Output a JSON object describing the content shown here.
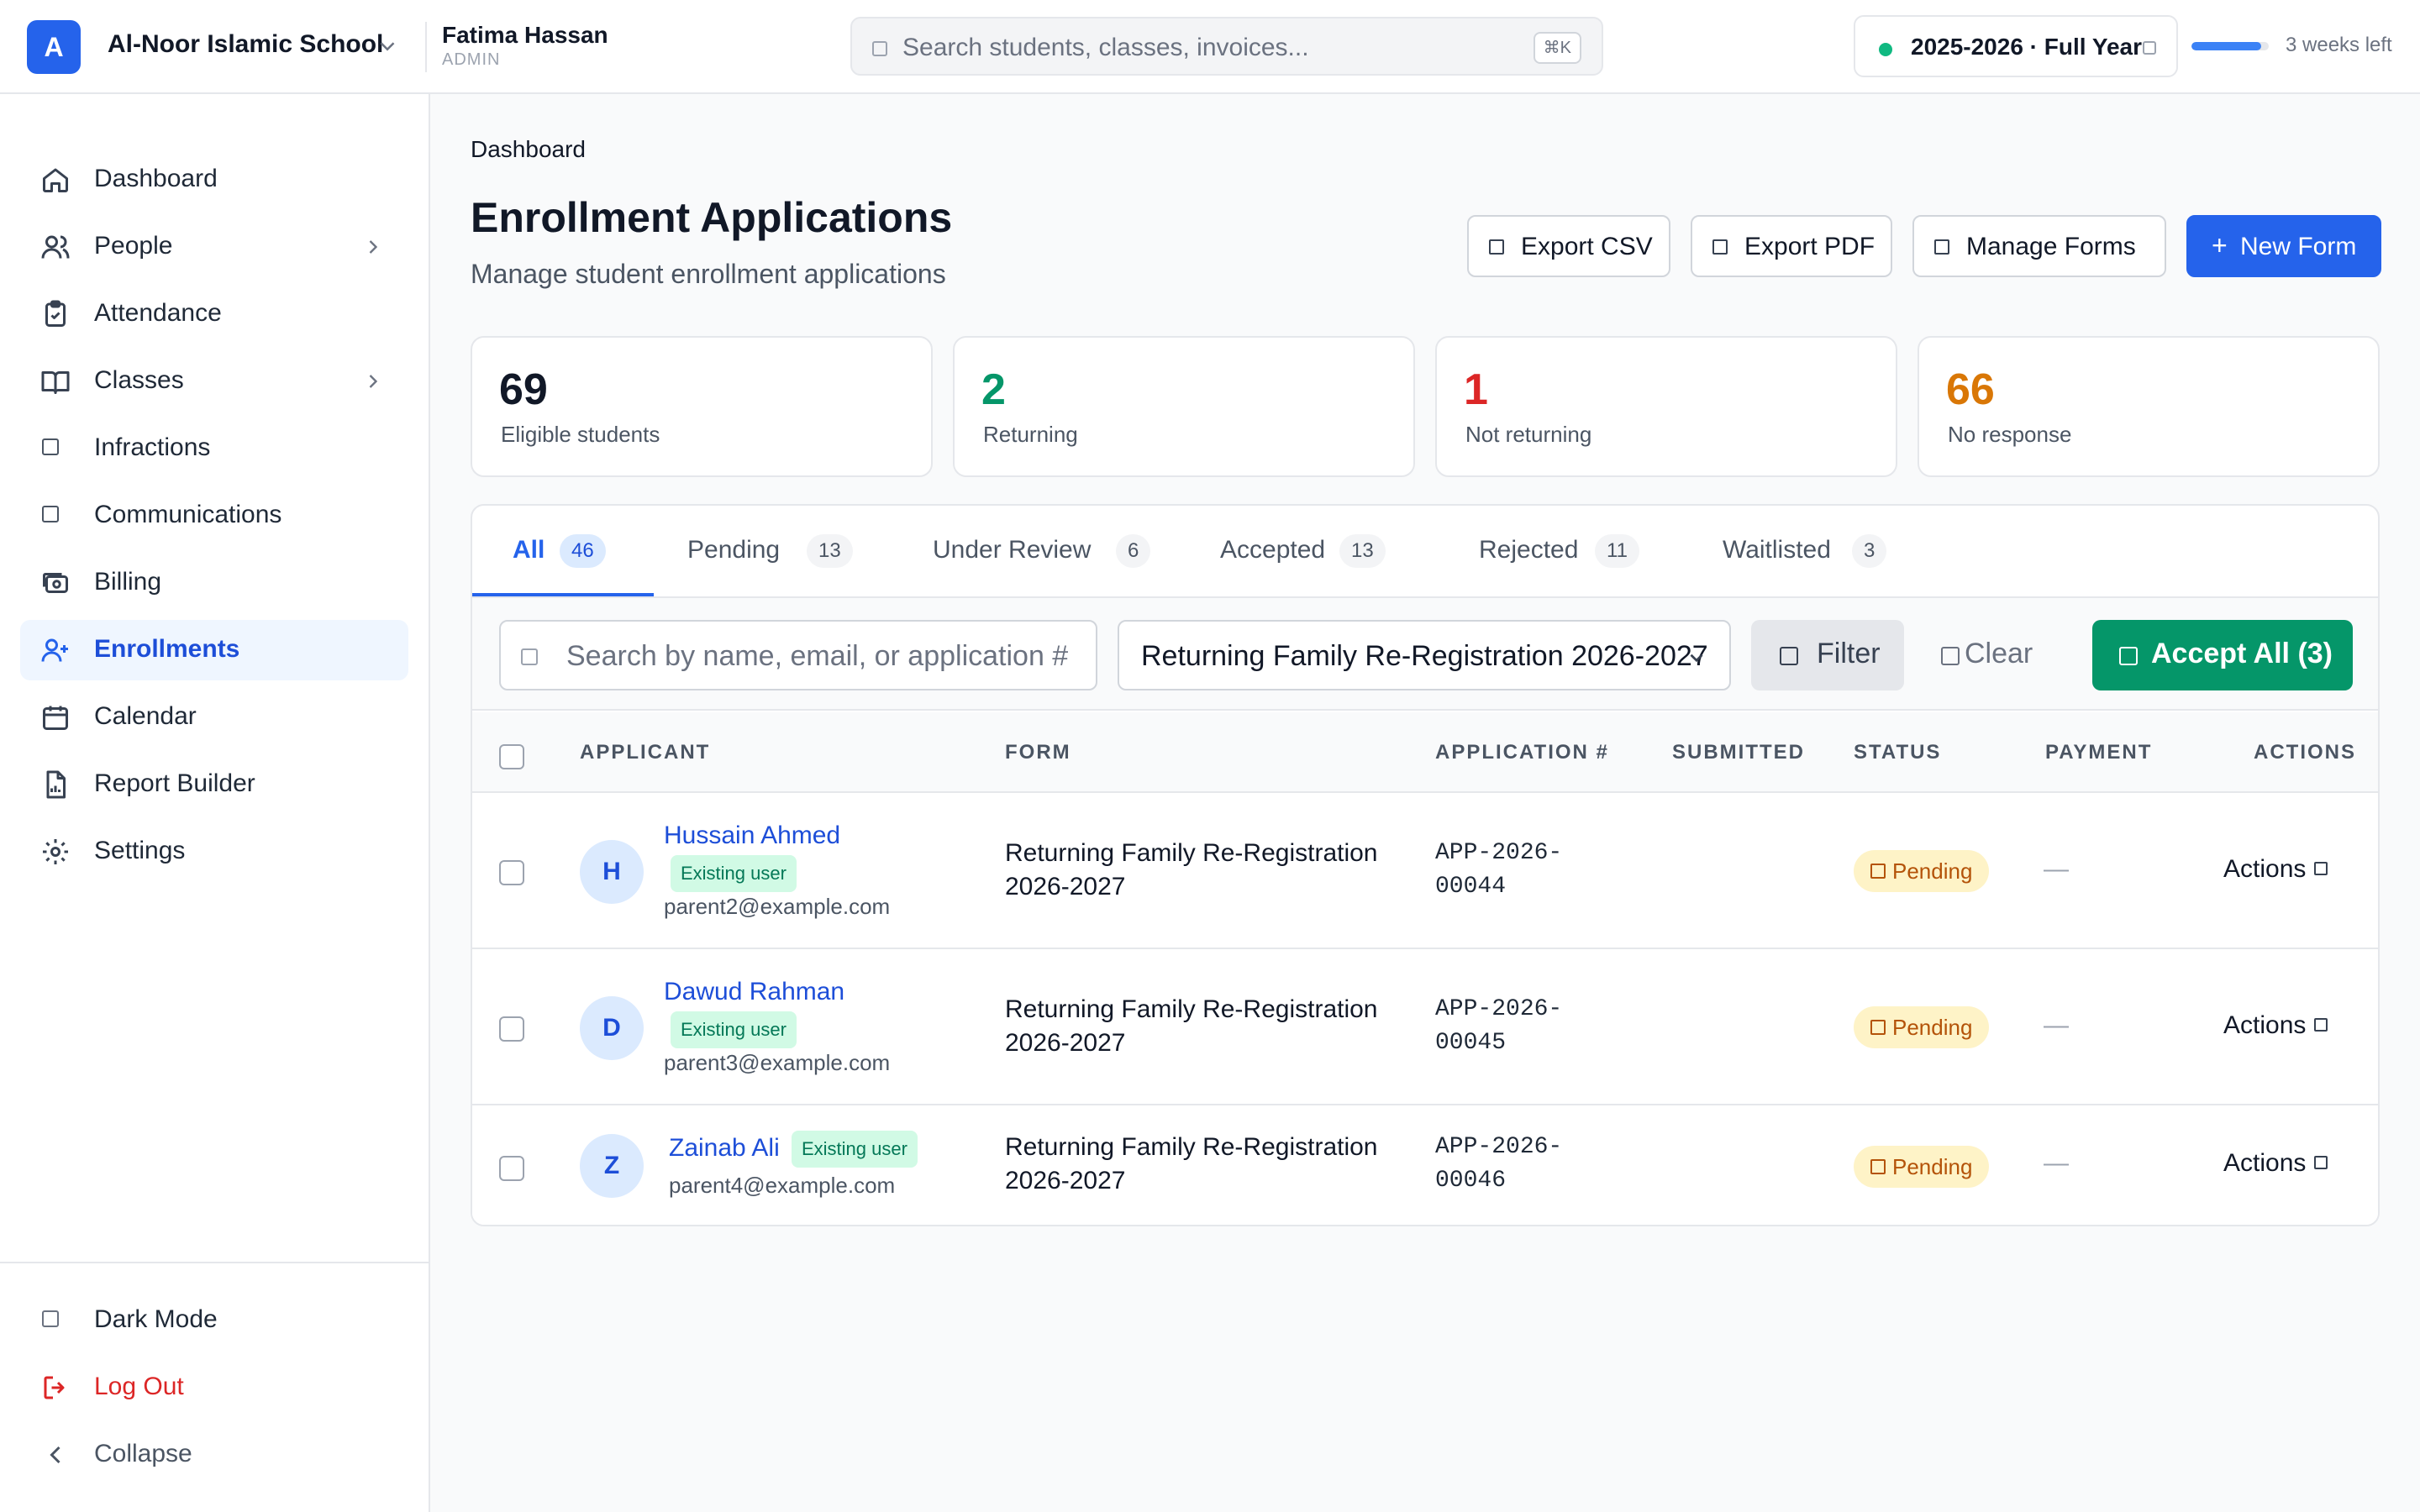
{
  "header": {
    "logo_letter": "A",
    "school_name": "Al-Noor Islamic School",
    "user_name": "Fatima Hassan",
    "user_role": "ADMIN",
    "search_placeholder": "Search students, classes, invoices...",
    "search_shortcut": "⌘K",
    "school_year": "2025-2026 · Full Year",
    "year_status_color": "#10b981",
    "year_progress": 0.9,
    "time_left": "3 weeks left"
  },
  "sidebar": {
    "items": [
      {
        "label": "Dashboard",
        "icon": "home-icon"
      },
      {
        "label": "People",
        "icon": "people-icon",
        "expandable": true
      },
      {
        "label": "Attendance",
        "icon": "clipboard-check-icon"
      },
      {
        "label": "Classes",
        "icon": "book-icon",
        "expandable": true
      },
      {
        "label": "Infractions",
        "icon": "square-icon"
      },
      {
        "label": "Communications",
        "icon": "square-icon"
      },
      {
        "label": "Billing",
        "icon": "billing-icon"
      },
      {
        "label": "Enrollments",
        "icon": "user-plus-icon",
        "active": true
      },
      {
        "label": "Calendar",
        "icon": "calendar-icon"
      },
      {
        "label": "Report Builder",
        "icon": "report-icon"
      },
      {
        "label": "Settings",
        "icon": "gear-icon"
      }
    ],
    "footer": {
      "dark_mode": "Dark Mode",
      "logout": "Log Out",
      "collapse": "Collapse"
    }
  },
  "main": {
    "breadcrumb": "Dashboard",
    "title": "Enrollment Applications",
    "subtitle": "Manage student enrollment applications",
    "buttons": {
      "export_csv": "Export CSV",
      "export_pdf": "Export PDF",
      "manage_forms": "Manage Forms",
      "new_form": "New Form"
    },
    "stats": [
      {
        "value": "69",
        "label": "Eligible students",
        "color": "#111827"
      },
      {
        "value": "2",
        "label": "Returning",
        "color": "#059669"
      },
      {
        "value": "1",
        "label": "Not returning",
        "color": "#dc2626"
      },
      {
        "value": "66",
        "label": "No response",
        "color": "#d97706"
      }
    ],
    "tabs": [
      {
        "label": "All",
        "count": "46",
        "active": true
      },
      {
        "label": "Pending",
        "count": "13"
      },
      {
        "label": "Under Review",
        "count": "6"
      },
      {
        "label": "Accepted",
        "count": "13"
      },
      {
        "label": "Rejected",
        "count": "11"
      },
      {
        "label": "Waitlisted",
        "count": "3"
      }
    ],
    "filters": {
      "search_placeholder": "Search by name, email, or application #",
      "selected_form": "Returning Family Re-Registration 2026-2027",
      "filter_label": "Filter",
      "clear_label": "Clear",
      "accept_all_label": "Accept All (3)"
    },
    "table": {
      "columns": [
        "APPLICANT",
        "FORM",
        "APPLICATION #",
        "SUBMITTED",
        "STATUS",
        "PAYMENT",
        "ACTIONS"
      ],
      "rows": [
        {
          "initial": "H",
          "name": "Hussain Ahmed",
          "tag": "Existing user",
          "email": "parent2@example.com",
          "form": "Returning Family Re-Registration 2026-2027",
          "app_number": "APP-2026-00044",
          "submitted": "",
          "status": "Pending",
          "payment": "—",
          "actions": "Actions"
        },
        {
          "initial": "D",
          "name": "Dawud Rahman",
          "tag": "Existing user",
          "email": "parent3@example.com",
          "form": "Returning Family Re-Registration 2026-2027",
          "app_number": "APP-2026-00045",
          "submitted": "",
          "status": "Pending",
          "payment": "—",
          "actions": "Actions"
        },
        {
          "initial": "Z",
          "name": "Zainab Ali",
          "tag": "Existing user",
          "email": "parent4@example.com",
          "form": "Returning Family Re-Registration 2026-2027",
          "app_number": "APP-2026-00046",
          "submitted": "",
          "status": "Pending",
          "payment": "—",
          "actions": "Actions"
        }
      ]
    }
  }
}
